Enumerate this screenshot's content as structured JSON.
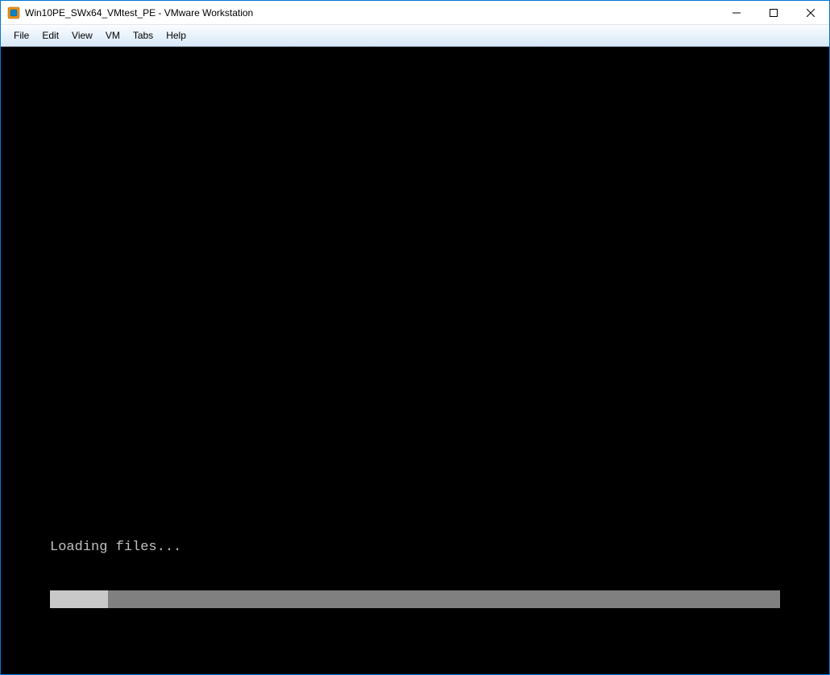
{
  "title_bar": {
    "title": "Win10PE_SWx64_VMtest_PE - VMware Workstation"
  },
  "menu": {
    "items": [
      {
        "label": "File"
      },
      {
        "label": "Edit"
      },
      {
        "label": "View"
      },
      {
        "label": "VM"
      },
      {
        "label": "Tabs"
      },
      {
        "label": "Help"
      }
    ]
  },
  "content": {
    "loading_text": "Loading files...",
    "progress_percent": 8
  }
}
